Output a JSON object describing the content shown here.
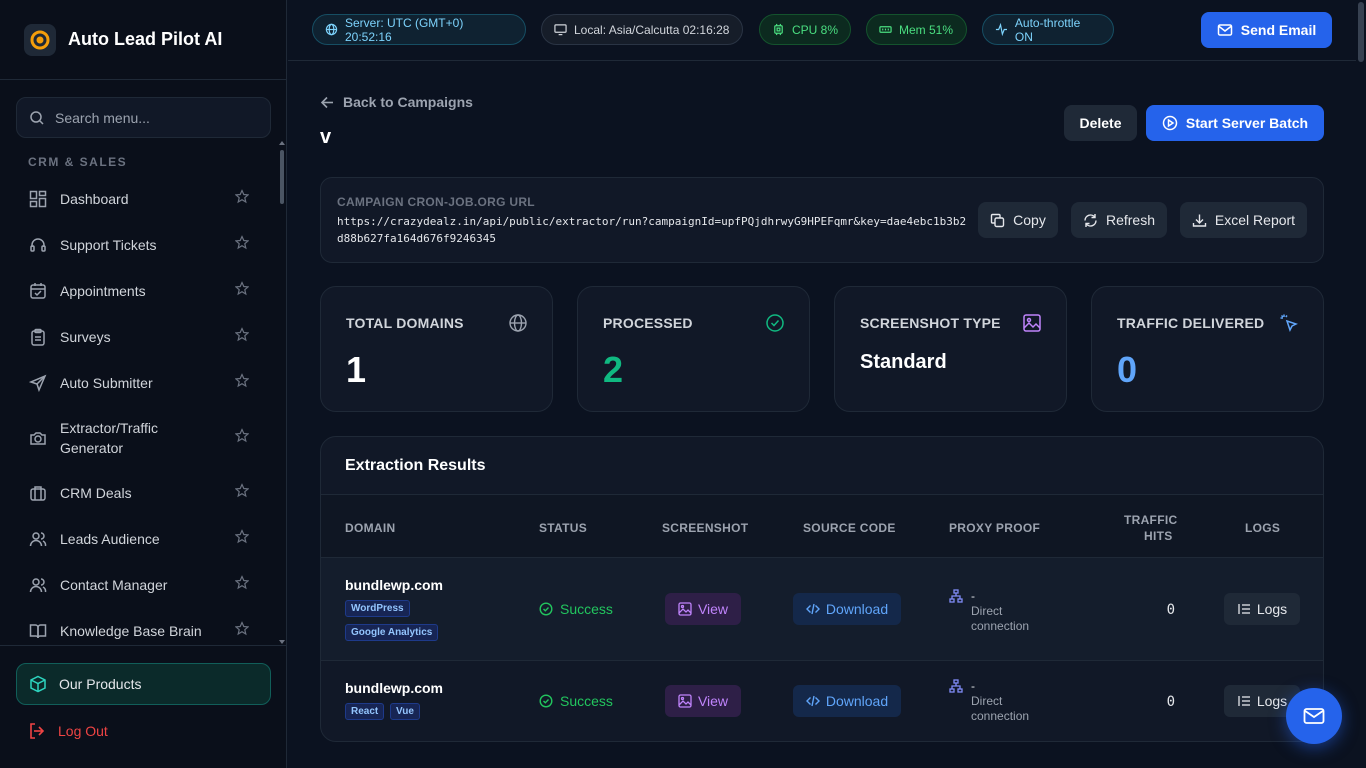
{
  "app": {
    "name": "Auto Lead Pilot AI"
  },
  "sidebar": {
    "search_placeholder": "Search menu...",
    "section": "CRM & SALES",
    "items": [
      {
        "label": "Dashboard",
        "icon": "dashboard-icon"
      },
      {
        "label": "Support Tickets",
        "icon": "headset-icon"
      },
      {
        "label": "Appointments",
        "icon": "calendar-icon"
      },
      {
        "label": "Surveys",
        "icon": "clipboard-icon"
      },
      {
        "label": "Auto Submitter",
        "icon": "send-icon"
      },
      {
        "label": "Extractor/Traffic Generator",
        "icon": "camera-icon"
      },
      {
        "label": "CRM Deals",
        "icon": "briefcase-icon"
      },
      {
        "label": "Leads Audience",
        "icon": "users-icon"
      },
      {
        "label": "Contact Manager",
        "icon": "users-icon"
      },
      {
        "label": "Knowledge Base Brain",
        "icon": "book-icon"
      }
    ],
    "products": "Our Products",
    "logout": "Log Out"
  },
  "topbar": {
    "server": "Server: UTC (GMT+0) 20:52:16",
    "local": "Local: Asia/Calcutta 02:16:28",
    "cpu": "CPU 8%",
    "mem": "Mem 51%",
    "throttle": "Auto-throttle ON",
    "send_email": "Send Email"
  },
  "page": {
    "back": "Back to Campaigns",
    "title": "v",
    "delete": "Delete",
    "start_batch": "Start Server Batch"
  },
  "cron": {
    "label": "CAMPAIGN CRON-JOB.ORG URL",
    "url": "https://crazydealz.in/api/public/extractor/run?campaignId=upfPQjdhrwyG9HPEFqmr&key=dae4ebc1b3b2d88b627fa164d676f9246345",
    "copy": "Copy",
    "refresh": "Refresh",
    "excel": "Excel Report"
  },
  "stats": [
    {
      "label": "TOTAL DOMAINS",
      "value": "1",
      "color": "#ffffff"
    },
    {
      "label": "PROCESSED",
      "value": "2",
      "color": "#10b981"
    },
    {
      "label": "SCREENSHOT TYPE",
      "value": "Standard",
      "color": "#ffffff"
    },
    {
      "label": "TRAFFIC DELIVERED",
      "value": "0",
      "color": "#60a5fa"
    }
  ],
  "results": {
    "title": "Extraction Results",
    "columns": {
      "domain": "DOMAIN",
      "status": "STATUS",
      "screenshot": "SCREENSHOT",
      "source": "SOURCE CODE",
      "proxy": "PROXY PROOF",
      "hits_1": "TRAFFIC",
      "hits_2": "HITS",
      "logs": "LOGS"
    },
    "rows": [
      {
        "domain": "bundlewp.com",
        "tags": [
          "WordPress",
          "Google Analytics"
        ],
        "status": "Success",
        "view": "View",
        "download": "Download",
        "proxy_dash": "-",
        "proxy_1": "Direct",
        "proxy_2": "connection",
        "hits": "0",
        "logs": "Logs"
      },
      {
        "domain": "bundlewp.com",
        "tags": [
          "React",
          "Vue"
        ],
        "status": "Success",
        "view": "View",
        "download": "Download",
        "proxy_dash": "-",
        "proxy_1": "Direct",
        "proxy_2": "connection",
        "hits": "0",
        "logs": "Logs"
      }
    ]
  },
  "colors": {
    "accent": "#2563eb",
    "success": "#22c55e",
    "danger": "#ef4444"
  }
}
